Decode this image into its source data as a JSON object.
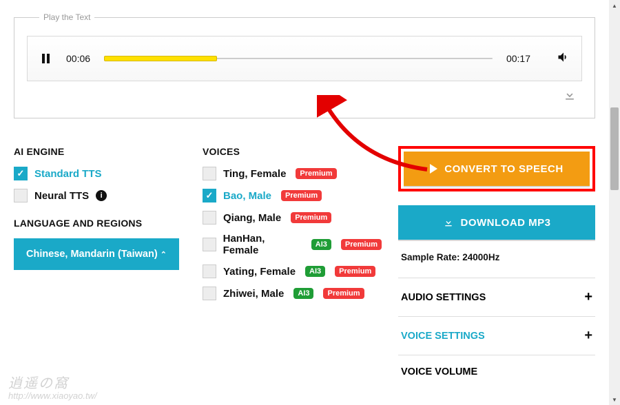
{
  "player": {
    "legend": "Play the Text",
    "current": "00:06",
    "total": "00:17",
    "progress_pct": 29
  },
  "sections": {
    "ai_engine": "AI ENGINE",
    "lang_regions": "LANGUAGE AND REGIONS",
    "voices": "VOICES"
  },
  "engines": [
    {
      "label": "Standard TTS",
      "checked": true,
      "info": false
    },
    {
      "label": "Neural TTS",
      "checked": false,
      "info": true
    }
  ],
  "language_button": "Chinese, Mandarin (Taiwan)",
  "voices": [
    {
      "label": "Ting, Female",
      "checked": false,
      "ai": false,
      "premium": true
    },
    {
      "label": "Bao, Male",
      "checked": true,
      "ai": false,
      "premium": true
    },
    {
      "label": "Qiang, Male",
      "checked": false,
      "ai": false,
      "premium": true
    },
    {
      "label": "HanHan, Female",
      "checked": false,
      "ai": true,
      "premium": true
    },
    {
      "label": "Yating, Female",
      "checked": false,
      "ai": true,
      "premium": true
    },
    {
      "label": "Zhiwei, Male",
      "checked": false,
      "ai": true,
      "premium": true
    }
  ],
  "badges": {
    "premium": "Premium",
    "ai": "AI3"
  },
  "right": {
    "convert": "CONVERT TO SPEECH",
    "download": "DOWNLOAD MP3",
    "sample_rate": "Sample Rate: 24000Hz",
    "audio_settings": "AUDIO SETTINGS",
    "voice_settings": "VOICE SETTINGS",
    "voice_volume": "VOICE VOLUME"
  },
  "watermark": {
    "cn": "逍遥の窩",
    "url": "http://www.xiaoyao.tw/"
  }
}
